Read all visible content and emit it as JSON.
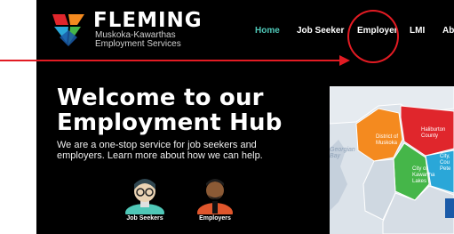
{
  "brand": {
    "name": "FLEMING",
    "subtitle_line1": "Muskoka-Kawarthas",
    "subtitle_line2": "Employment Services"
  },
  "nav": {
    "items": [
      {
        "label": "Home",
        "active": true
      },
      {
        "label": "Job Seeker"
      },
      {
        "label": "Employer"
      },
      {
        "label": "LMI"
      },
      {
        "label": "Ab"
      }
    ]
  },
  "hero": {
    "title_line1": "Welcome to our",
    "title_line2": "Employment Hub",
    "subtitle": "We are a one-stop service for job seekers and employers. Learn more about how we can help."
  },
  "audiences": [
    {
      "label": "Job Seekers"
    },
    {
      "label": "Employers"
    }
  ],
  "map": {
    "labels": {
      "muskoka": "District of Muskoka",
      "haliburton": "Haliburton County",
      "kawartha": "City of Kawartha Lakes",
      "peterborough": "City, Cou Pete",
      "georgian_bay": "Georgian Bay"
    }
  },
  "colors": {
    "accent": "#4fc7b7",
    "annotation": "#e21b23",
    "muskoka": "#f48a1f",
    "haliburton": "#e0262c",
    "kawartha": "#45b649",
    "peterborough": "#2aa7d8"
  }
}
